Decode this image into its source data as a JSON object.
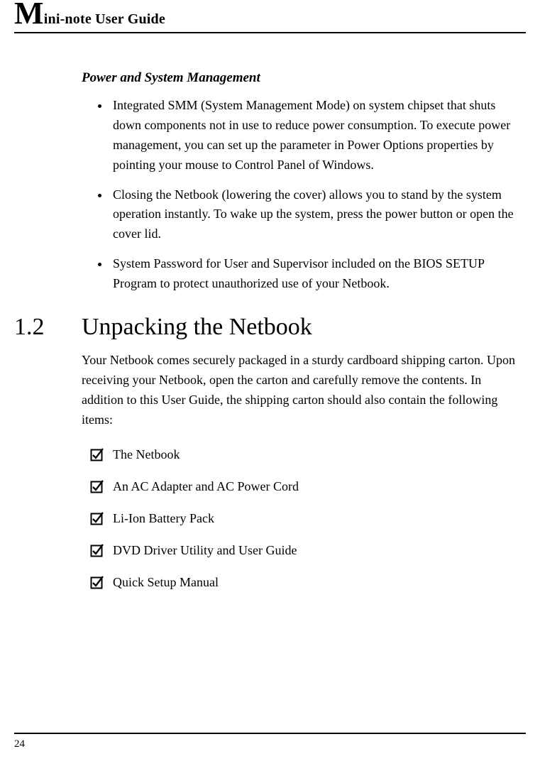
{
  "header": {
    "title_prefix_letter": "M",
    "title_rest": "ini-note User Guide"
  },
  "power_section": {
    "heading": "Power and System Management",
    "bullets": [
      "Integrated SMM (System Management Mode) on system chipset that shuts down components not in use to reduce power consumption. To execute power management, you can set up the parameter in Power Options properties by pointing your mouse to Control Panel of Windows.",
      "Closing the Netbook (lowering the cover) allows you to stand by the system operation instantly. To wake up the system, press the power button or open the cover lid.",
      "System Password for User and Supervisor included on the BIOS SETUP Program to protect unauthorized use of your Netbook."
    ]
  },
  "unpacking_section": {
    "number": "1.2",
    "title": "Unpacking the Netbook",
    "intro": "Your Netbook comes securely packaged in a sturdy cardboard shipping carton. Upon receiving your Netbook, open the carton and carefully remove the contents. In addition to this User Guide, the shipping carton should also contain the following items:",
    "items": [
      "The Netbook",
      "An AC Adapter and AC Power Cord",
      "Li-Ion Battery Pack",
      "DVD Driver Utility and User Guide",
      "Quick Setup Manual"
    ]
  },
  "page_number": "24"
}
